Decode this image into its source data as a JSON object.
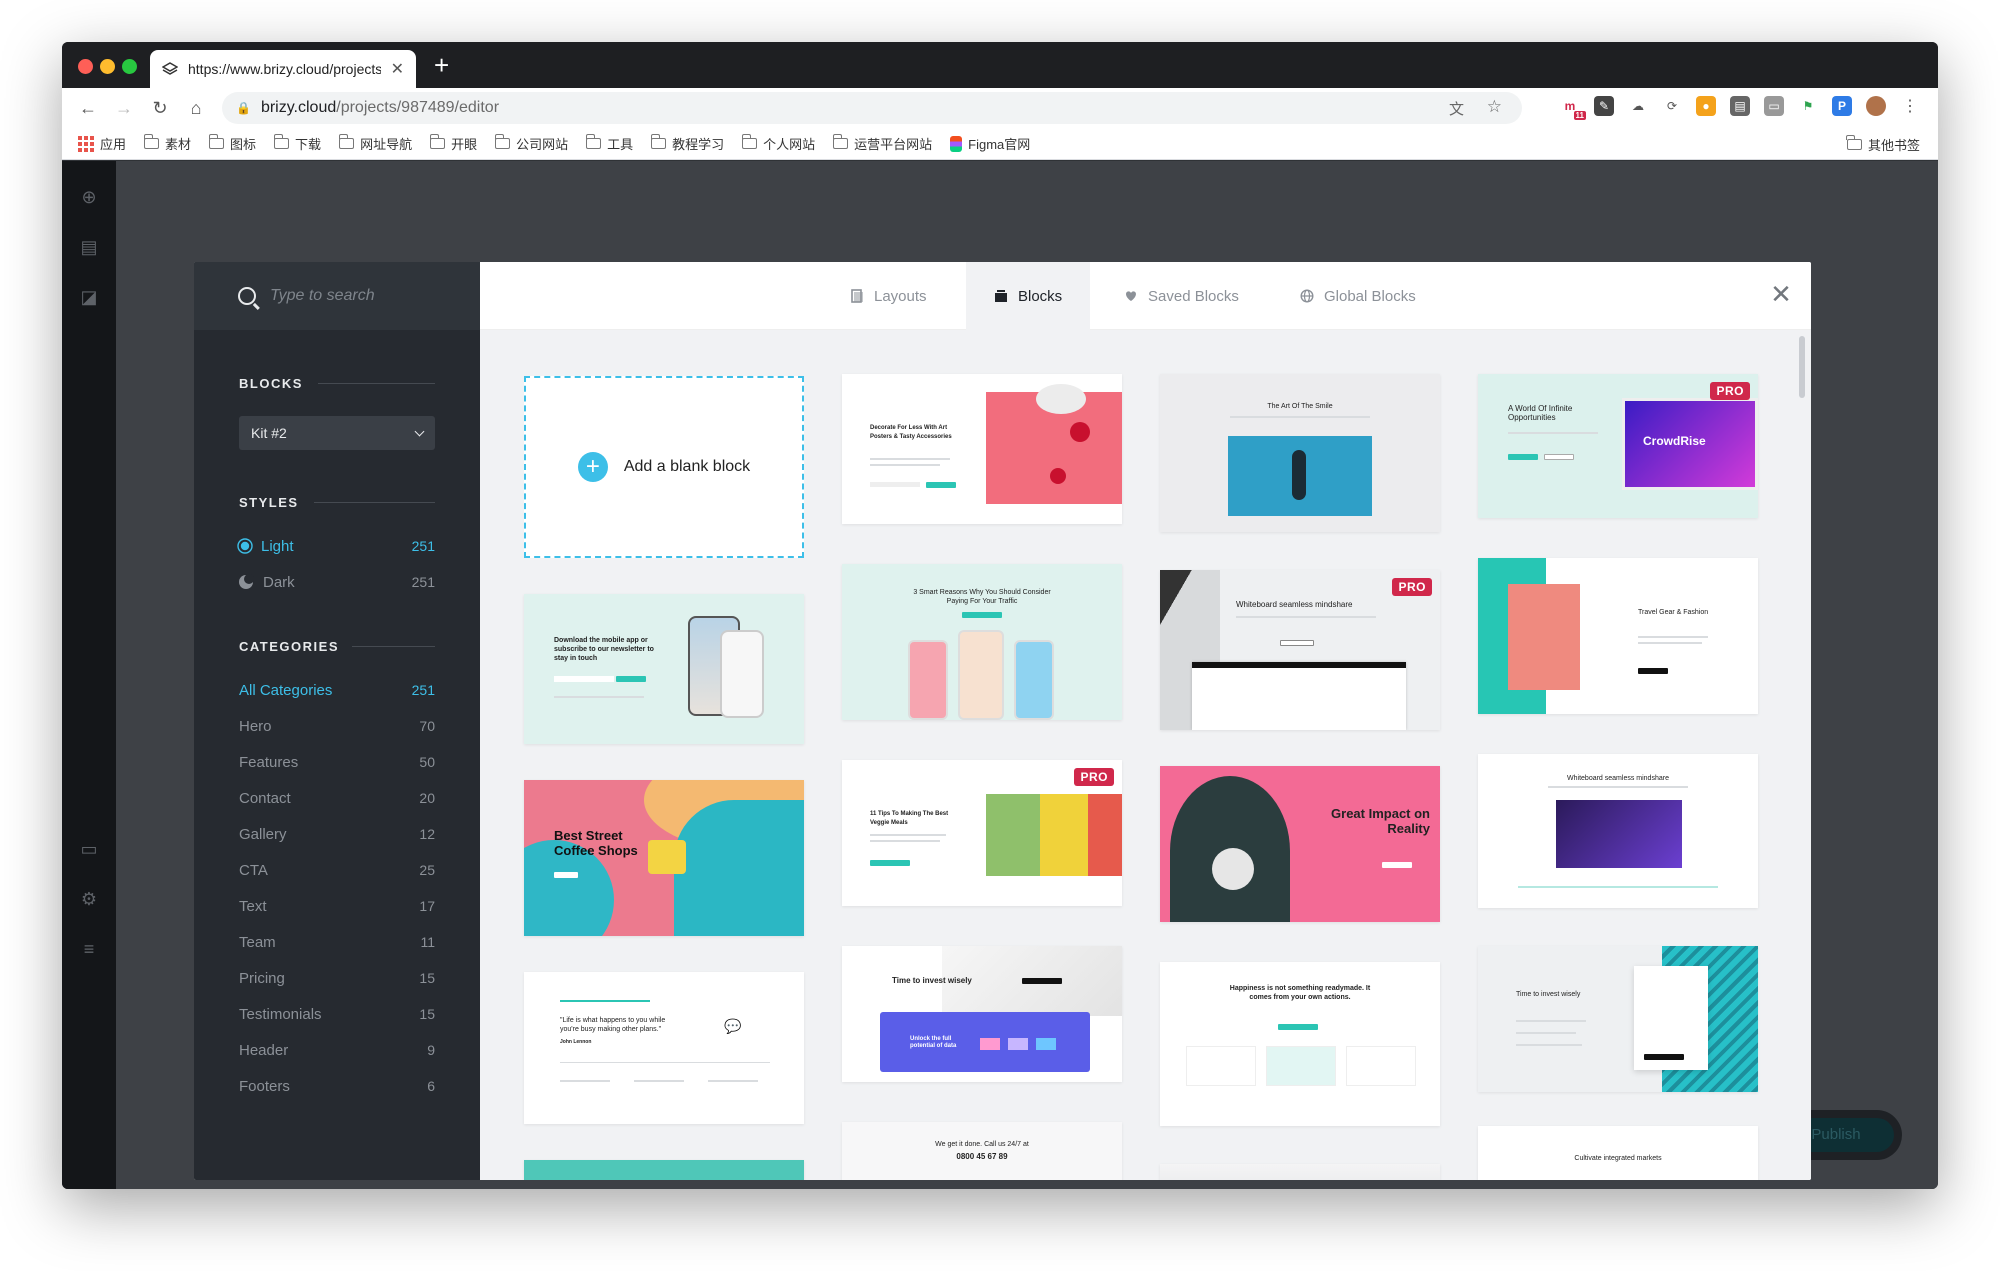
{
  "browser": {
    "tab_title": "https://www.brizy.cloud/projects",
    "url_host": "brizy.cloud",
    "url_path": "/projects/987489/editor",
    "bookmarks": [
      "应用",
      "素材",
      "图标",
      "下载",
      "网址导航",
      "开眼",
      "公司网站",
      "工具",
      "教程学习",
      "个人网站",
      "运营平台网站",
      "Figma官网"
    ],
    "bookmarks_right": "其他书签",
    "ext_badge": "11"
  },
  "search": {
    "placeholder": "Type to search"
  },
  "sidebar": {
    "blocks_title": "BLOCKS",
    "kit_value": "Kit #2",
    "styles_title": "STYLES",
    "styles": [
      {
        "label": "Light",
        "count": "251"
      },
      {
        "label": "Dark",
        "count": "251"
      }
    ],
    "categories_title": "CATEGORIES",
    "categories": [
      {
        "label": "All Categories",
        "count": "251"
      },
      {
        "label": "Hero",
        "count": "70"
      },
      {
        "label": "Features",
        "count": "50"
      },
      {
        "label": "Contact",
        "count": "20"
      },
      {
        "label": "Gallery",
        "count": "12"
      },
      {
        "label": "CTA",
        "count": "25"
      },
      {
        "label": "Text",
        "count": "17"
      },
      {
        "label": "Team",
        "count": "11"
      },
      {
        "label": "Pricing",
        "count": "15"
      },
      {
        "label": "Testimonials",
        "count": "15"
      },
      {
        "label": "Header",
        "count": "9"
      },
      {
        "label": "Footers",
        "count": "6"
      }
    ]
  },
  "tabs": [
    {
      "label": "Layouts"
    },
    {
      "label": "Blocks"
    },
    {
      "label": "Saved Blocks"
    },
    {
      "label": "Global Blocks"
    }
  ],
  "blank_block": "Add a blank block",
  "pro_label": "PRO",
  "publish_label": "Publish",
  "cards": {
    "c1": "Decorate For Less With Art Posters & Tasty Accessories",
    "c2": "The Art Of The Smile",
    "c3": "A World Of Infinite Opportunities",
    "c3_brand": "CrowdRise",
    "c4": "Download the mobile app or subscribe to our newsletter to stay in touch",
    "c5": "3 Smart Reasons Why You Should Consider Paying For Your Traffic",
    "c6": "Whiteboard seamless mindshare",
    "c7": "Travel Gear & Fashion",
    "c8": "Best Street Coffee Shops",
    "c9": "11 Tips To Making The Best Veggie Meals",
    "c10": "Great Impact on Reality",
    "c11": "Whiteboard seamless mindshare",
    "c12": "\"Life is what happens to you while you're busy making other plans.\"",
    "c12_author": "John Lennon",
    "c13": "Time to invest wisely",
    "c13_sub": "Unlock the full potential of data",
    "c14": "Happiness is not something readymade. It comes from your own actions.",
    "c15": "Time to invest wisely",
    "c16": "We get it done. Call us 24/7 at",
    "c16_phone": "0800 45 67 89",
    "c17": "Cultivate integrated markets"
  }
}
